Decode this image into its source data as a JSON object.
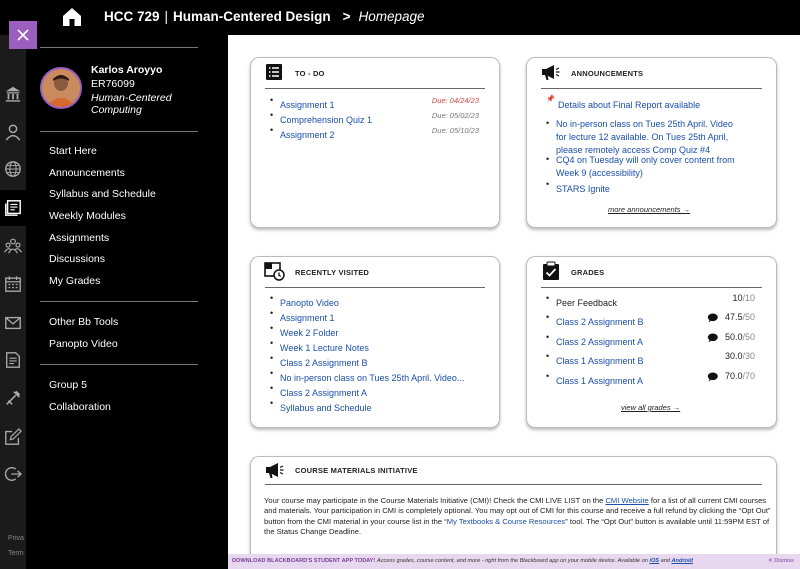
{
  "header": {
    "course_code": "HCC 729",
    "separator": "|",
    "course_name": "Human-Centered Design",
    "arrow": ">",
    "page_title": "Homepage"
  },
  "profile": {
    "name": "Karlos Aroyyo",
    "id": "ER76099",
    "program": "Human-Centered Computing"
  },
  "menu": {
    "section1": [
      "Start Here",
      "Announcements",
      "Syllabus and Schedule",
      "Weekly Modules",
      "Assignments",
      "Discussions",
      "My Grades"
    ],
    "section2": [
      "Other Bb Tools",
      "Panopto Video"
    ],
    "section3": [
      "Group 5",
      "Collaboration"
    ]
  },
  "rail": {
    "icons": [
      "institution-icon",
      "profile-icon",
      "globe-icon",
      "courses-icon",
      "groups-icon",
      "calendar-icon",
      "messages-icon",
      "grades-icon",
      "tools-icon",
      "edit-icon",
      "signout-icon"
    ],
    "privacy_text": "Priva",
    "terms_text": "Term"
  },
  "todo": {
    "title": "TO - DO",
    "items": [
      {
        "label": "Assignment 1",
        "due": "Due: 04/24/23",
        "overdue": true
      },
      {
        "label": "Comprehension Quiz 1",
        "due": "Due: 05/02/23",
        "overdue": false
      },
      {
        "label": "Assignment 2",
        "due": "Due: 05/10/23",
        "overdue": false
      }
    ]
  },
  "announcements": {
    "title": "ANNOUNCEMENTS",
    "pinned": "Details about Final Report available",
    "items": [
      [
        "No in-person class on Tues 25th April. Video",
        "for lecture 12 available. On Tues 25th April,",
        "please remotely access Comp Quiz #4"
      ],
      [
        "CQ4 on Tuesday will only cover content from",
        "Week 9 (accessibility)"
      ],
      [
        "STARS Ignite"
      ]
    ],
    "more_label": "more announcements →"
  },
  "recent": {
    "title": "RECENTLY VISITED",
    "items": [
      "Panopto Video",
      "Assignment 1",
      "Week 2 Folder",
      "Week 1 Lecture Notes",
      "Class 2 Assignment B",
      "No in-person class on Tues 25th April. Video...",
      "Class 2 Assignment A",
      "Syllabus and Schedule"
    ]
  },
  "grades": {
    "title": "GRADES",
    "items": [
      {
        "label": "Peer Feedback",
        "linked": false,
        "comment": false,
        "score": "10",
        "total": "/10"
      },
      {
        "label": "Class 2 Assignment B",
        "linked": true,
        "comment": true,
        "score": "47.5",
        "total": "/50"
      },
      {
        "label": "Class 2 Assignment A",
        "linked": true,
        "comment": true,
        "score": "50.0",
        "total": "/50"
      },
      {
        "label": "Class 1 Assignment B",
        "linked": true,
        "comment": false,
        "score": "30.0",
        "total": "/30"
      },
      {
        "label": "Class 1 Assignment A",
        "linked": true,
        "comment": true,
        "score": "70.0",
        "total": "/70"
      }
    ],
    "view_all_label": "view all grades →"
  },
  "cmi": {
    "title": "COURSE MATERIALS INITIATIVE",
    "t1": "Your course may participate in the Course Materials Initiative (CMI)! Check the CMI LIVE LIST on the ",
    "link1": "CMI Website",
    "t2": " for a list of all current CMI courses and materials. Your participation in CMI is completely optional. You may opt out of CMI for this course and receive a full refund by clicking the “Opt Out” button from the CMI material in your course list in the “",
    "link2": "My Textbooks & Course Resources",
    "t3": "” tool. The “Opt Out” button is available until 11:59PM EST of the Status Change Deadline."
  },
  "banner": {
    "headline": "DOWNLOAD BLACKBOARD'S STUDENT APP TODAY!",
    "text": "Access grades, course content, and more - right from the Blackboard app on your mobile device. Available on ",
    "ios": "iOS",
    "and": " and ",
    "android": "Android",
    "dismiss": "✕ Dismiss"
  },
  "colors": {
    "accent": "#9b5fc0",
    "link": "#1a4faa",
    "overdue": "#d0464a",
    "banner_bg": "#e8d8ef"
  }
}
